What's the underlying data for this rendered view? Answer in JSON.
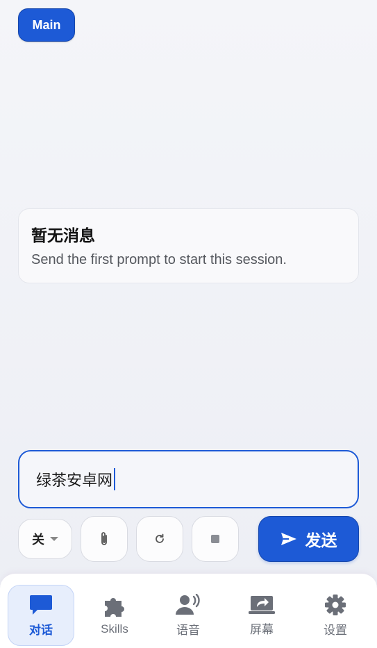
{
  "session": {
    "label": "Main"
  },
  "empty_state": {
    "title": "暂无消息",
    "subtitle": "Send the first prompt to start this session."
  },
  "composer": {
    "input_value": "绿茶安卓网",
    "toggle_label": "关",
    "send_label": "发送"
  },
  "tabs": [
    {
      "label": "对话",
      "icon": "chat-icon",
      "active": true
    },
    {
      "label": "Skills",
      "icon": "puzzle-icon",
      "active": false
    },
    {
      "label": "语音",
      "icon": "voice-icon",
      "active": false
    },
    {
      "label": "屏幕",
      "icon": "screen-share-icon",
      "active": false
    },
    {
      "label": "设置",
      "icon": "gear-icon",
      "active": false
    }
  ],
  "colors": {
    "accent": "#1d5ad6",
    "icon_gray": "#6b6f78"
  }
}
